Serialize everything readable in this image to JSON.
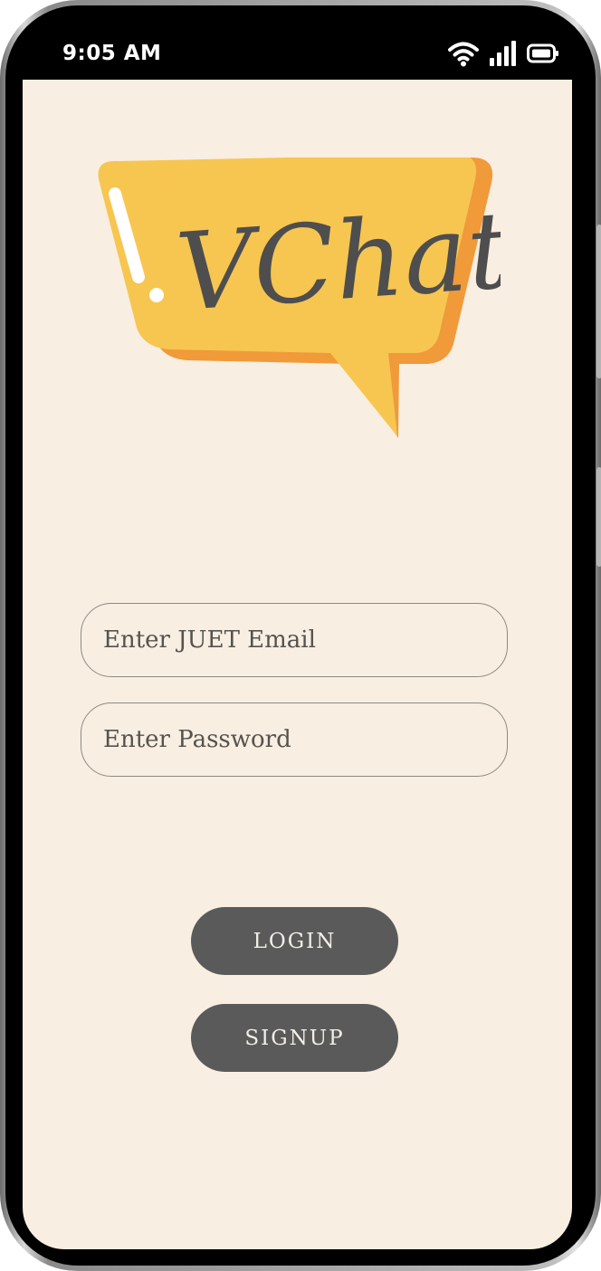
{
  "status_bar": {
    "time": "9:05 AM",
    "icons": [
      "wifi-icon",
      "signal-icon",
      "battery-icon"
    ]
  },
  "logo": {
    "text": "VChat",
    "colors": {
      "bubble": "#f7c651",
      "bubble_shadow": "#f09a3a",
      "text": "#4e4e4e",
      "accent": "#ffffff"
    }
  },
  "form": {
    "email_placeholder": "Enter JUET Email",
    "password_placeholder": "Enter Password"
  },
  "buttons": {
    "login_label": "LOGIN",
    "signup_label": "SIGNUP"
  },
  "colors": {
    "background": "#f8eee2",
    "button": "#5a5a5a",
    "button_text": "#f2eee8",
    "field_border": "#8e8a82"
  }
}
